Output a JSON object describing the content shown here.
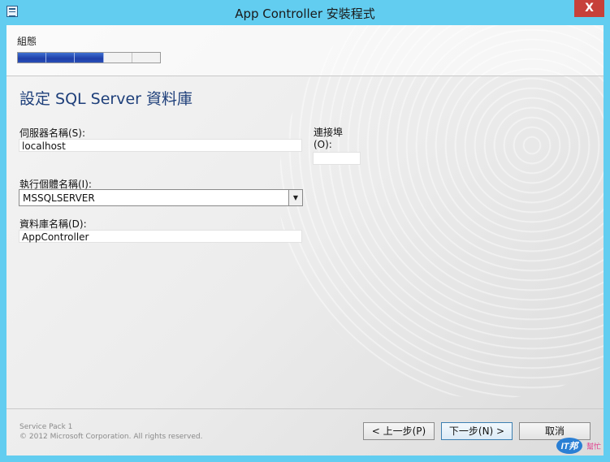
{
  "window": {
    "title": "App Controller 安裝程式",
    "close_glyph": "X"
  },
  "header": {
    "step_label": "組態",
    "progress": {
      "completed_segments": 3,
      "total_segments": 5
    }
  },
  "page": {
    "title": "設定 SQL Server 資料庫"
  },
  "form": {
    "server_name": {
      "label": "伺服器名稱(S):",
      "value": "localhost"
    },
    "port": {
      "label_line1": "連接埠",
      "label_line2": "(O):",
      "value": ""
    },
    "instance_name": {
      "label": "執行個體名稱(I):",
      "value": "MSSQLSERVER"
    },
    "database_name": {
      "label": "資料庫名稱(D):",
      "value": "AppController"
    }
  },
  "footer": {
    "service_pack": "Service Pack 1",
    "copyright": "© 2012 Microsoft Corporation. All rights reserved.",
    "back_label": "< 上一步(P)",
    "next_label": "下一步(N) >",
    "cancel_label": "取消"
  },
  "watermark": {
    "text": "IT邦幫忙"
  },
  "colors": {
    "titlebar": "#62cdf0",
    "close_button": "#c7413a",
    "page_title": "#1e3f7a",
    "progress_fill": "#2a4fb8"
  }
}
